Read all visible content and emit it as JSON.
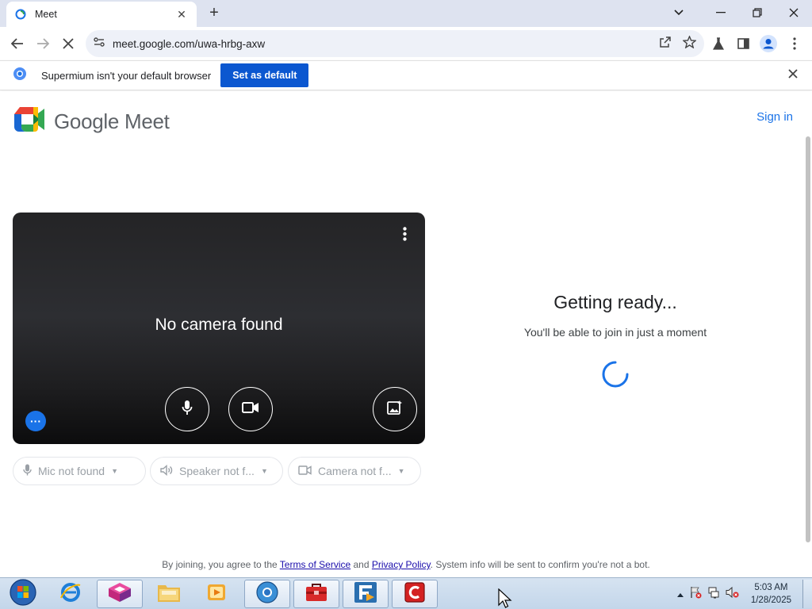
{
  "browser": {
    "tab_title": "Meet",
    "url": "meet.google.com/uwa-hrbg-axw",
    "infobar_text": "Supermium isn't your default browser",
    "infobar_button": "Set as default"
  },
  "header": {
    "brand": "Google Meet",
    "sign_in": "Sign in"
  },
  "preview": {
    "message": "No camera found"
  },
  "devices": {
    "mic": "Mic not found",
    "speaker": "Speaker not f...",
    "camera": "Camera not f..."
  },
  "status": {
    "title": "Getting ready...",
    "subtitle": "You'll be able to join in just a moment"
  },
  "footer": {
    "prefix": "By joining, you agree to the",
    "terms": "Terms of Service",
    "and": "and",
    "privacy": "Privacy Policy",
    "suffix": ". System info will be sent to confirm you're not a bot."
  },
  "taskbar": {
    "time": "5:03 AM",
    "date": "1/28/2025"
  },
  "colors": {
    "accent": "#1a73e8",
    "infobar_button": "#0b57d0"
  }
}
